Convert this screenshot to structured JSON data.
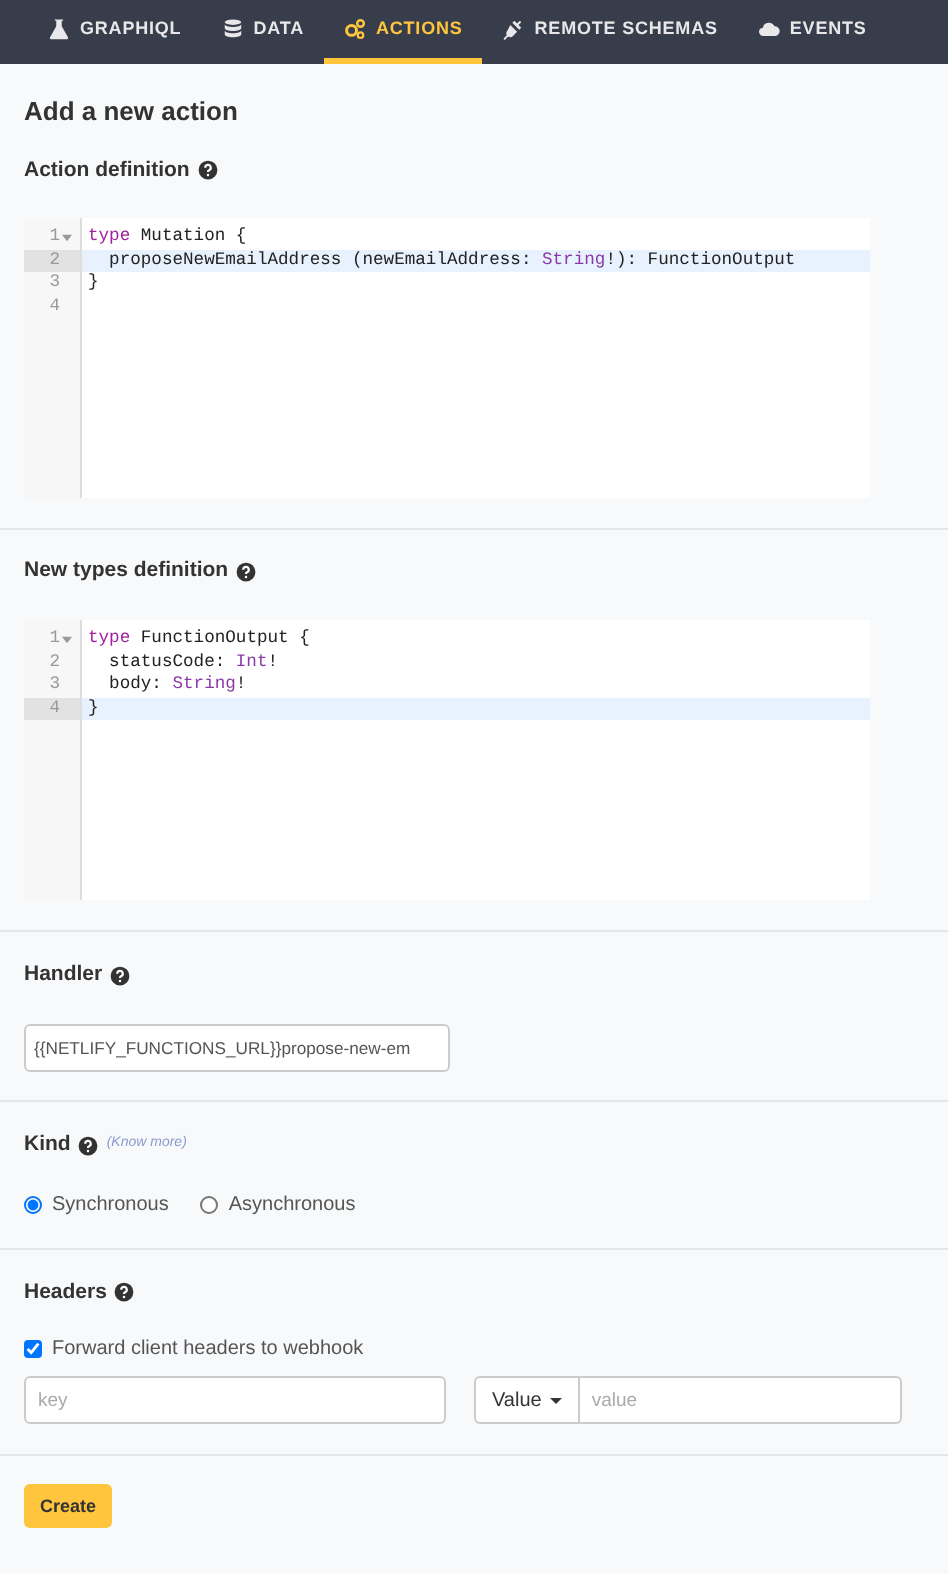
{
  "nav_tabs": [
    {
      "label": "GRAPHIQL",
      "selected": false
    },
    {
      "label": "DATA",
      "selected": false
    },
    {
      "label": "ACTIONS",
      "selected": true
    },
    {
      "label": "REMOTE SCHEMAS",
      "selected": false
    },
    {
      "label": "EVENTS",
      "selected": false
    }
  ],
  "page_title": "Add a new action",
  "action_definition": {
    "label": "Action definition",
    "lines": [
      {
        "number": "1",
        "fold": true,
        "active": false,
        "tokens": [
          {
            "text": "type",
            "kind": "keyword"
          },
          {
            "text": " Mutation {",
            "kind": "plain"
          }
        ]
      },
      {
        "number": "2",
        "fold": false,
        "active": true,
        "tokens": [
          {
            "text": "  proposeNewEmailAddress (newEmailAddress: ",
            "kind": "plain"
          },
          {
            "text": "String",
            "kind": "builtin"
          },
          {
            "text": "!): FunctionOutput",
            "kind": "plain"
          }
        ]
      },
      {
        "number": "3",
        "fold": false,
        "active": false,
        "tokens": [
          {
            "text": "}",
            "kind": "plain"
          }
        ]
      },
      {
        "number": "4",
        "fold": false,
        "active": false
      }
    ]
  },
  "types_definition": {
    "label": "New types definition",
    "lines": [
      {
        "number": "1",
        "fold": true,
        "active": false,
        "tokens": [
          {
            "text": "type",
            "kind": "keyword"
          },
          {
            "text": " FunctionOutput {",
            "kind": "plain"
          }
        ]
      },
      {
        "number": "2",
        "fold": false,
        "active": false,
        "tokens": [
          {
            "text": "  statusCode: ",
            "kind": "plain"
          },
          {
            "text": "Int",
            "kind": "builtin"
          },
          {
            "text": "!",
            "kind": "plain"
          }
        ]
      },
      {
        "number": "3",
        "fold": false,
        "active": false,
        "tokens": [
          {
            "text": "  body: ",
            "kind": "plain"
          },
          {
            "text": "String",
            "kind": "builtin"
          },
          {
            "text": "!",
            "kind": "plain"
          }
        ]
      },
      {
        "number": "4",
        "fold": false,
        "active": true,
        "tokens": [
          {
            "text": "}",
            "kind": "plain"
          }
        ]
      }
    ]
  },
  "handler": {
    "label": "Handler",
    "value": "{{NETLIFY_FUNCTIONS_URL}}propose-new-em"
  },
  "kind": {
    "label": "Kind",
    "link": "(Know more)",
    "options": [
      {
        "label": "Synchronous",
        "selected": true
      },
      {
        "label": "Asynchronous",
        "selected": false
      }
    ]
  },
  "headers": {
    "label": "Headers",
    "forward": {
      "label": "Forward client headers to webhook",
      "checked": true
    },
    "key_placeholder": "key",
    "value_type": "Value",
    "value_placeholder": "value"
  },
  "create_button": "Create"
}
